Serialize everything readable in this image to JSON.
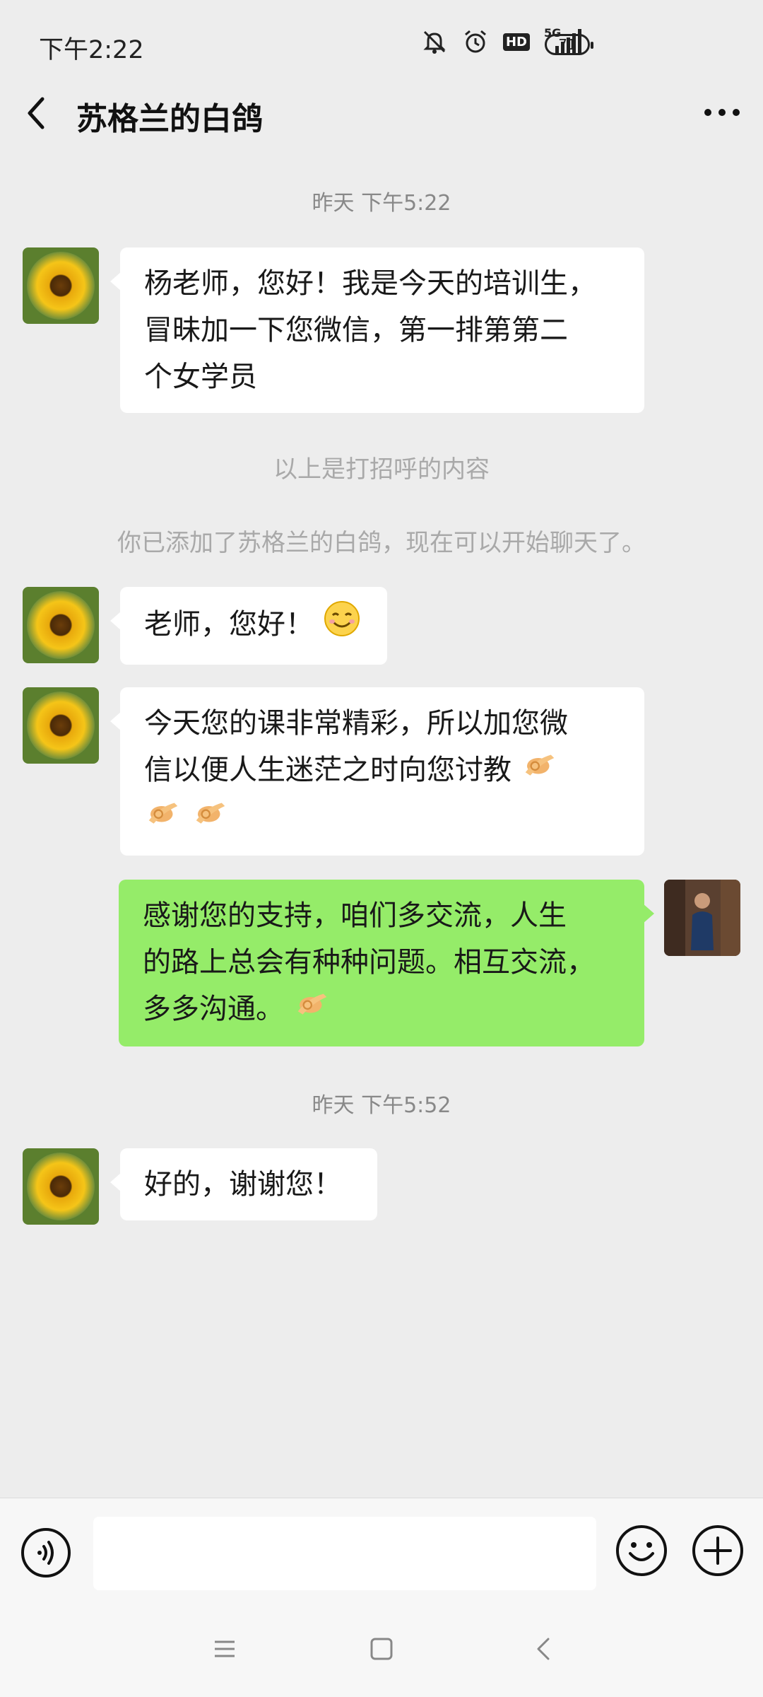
{
  "status_bar": {
    "time": "下午2:22",
    "network_type": "5G",
    "hd_label": "HD",
    "battery_level": "71",
    "icons": [
      "mute-icon",
      "alarm-icon",
      "hd-icon",
      "signal-icon",
      "battery-icon"
    ]
  },
  "header": {
    "title": "苏格兰的白鸽",
    "back_icon": "back-arrow-icon",
    "more_icon": "more-icon"
  },
  "messages": [
    {
      "type": "timestamp",
      "text": "昨天 下午5:22"
    },
    {
      "type": "incoming",
      "lines": [
        "杨老师，您好！我是今天的培训生，",
        "冒昧加一下您微信，第一排第第二",
        "个女学员"
      ]
    },
    {
      "type": "system",
      "text": "以上是打招呼的内容"
    },
    {
      "type": "system",
      "text": "你已添加了苏格兰的白鸽，现在可以开始聊天了。"
    },
    {
      "type": "incoming",
      "text": "老师，您好！",
      "emoji": "smile-emoji"
    },
    {
      "type": "incoming",
      "lines": [
        "今天您的课非常精彩，所以加您微",
        "信以便人生迷茫之时向您讨教"
      ],
      "emoji": "ok-hand-emoji"
    },
    {
      "type": "outgoing",
      "lines": [
        "感谢您的支持，咱们多交流，人生",
        "的路上总会有种种问题。相互交流，",
        "多多沟通。"
      ],
      "emoji": "ok-hand-emoji"
    },
    {
      "type": "timestamp",
      "text": "昨天 下午5:52"
    },
    {
      "type": "incoming",
      "text": "好的，谢谢您！"
    }
  ],
  "input_bar": {
    "placeholder": "",
    "icons": [
      "voice-icon",
      "emoji-icon",
      "plus-icon"
    ]
  },
  "nav_bar": {
    "icons": [
      "menu-icon",
      "home-icon",
      "back-icon"
    ]
  },
  "colors": {
    "background": "#ededed",
    "incoming_bubble": "#ffffff",
    "outgoing_bubble": "#95ec69"
  }
}
